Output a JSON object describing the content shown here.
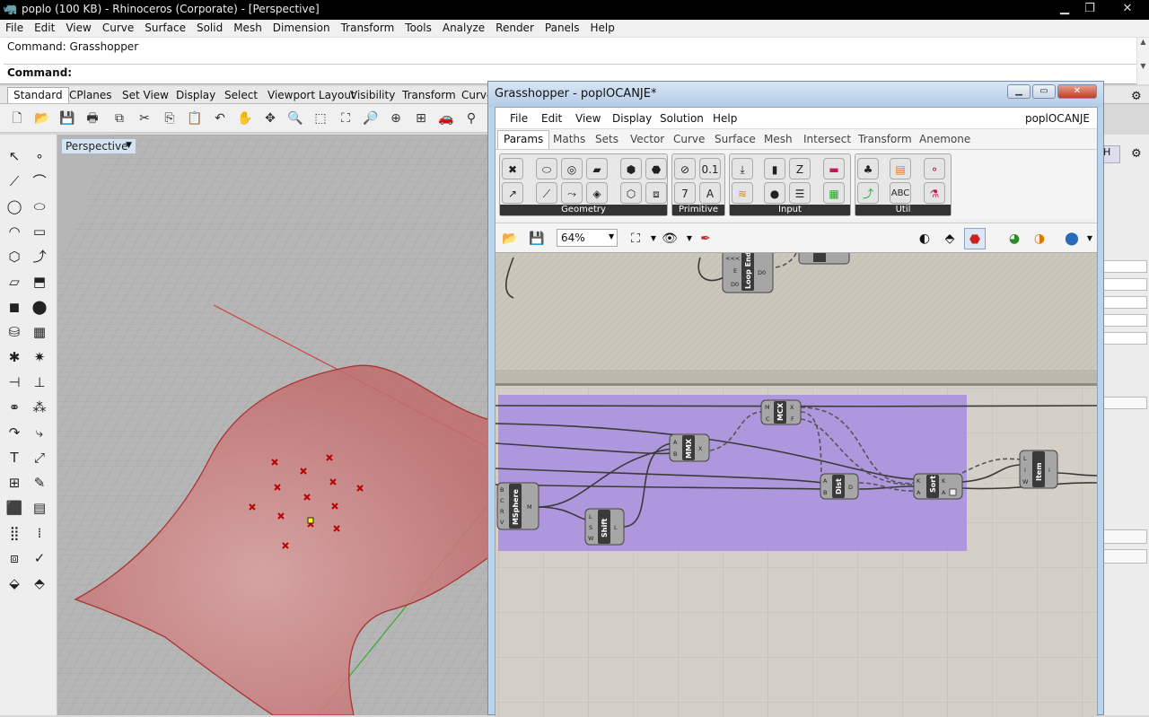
{
  "rhino": {
    "title": "poplo (100 KB) - Rhinoceros (Corporate) - [Perspective]",
    "menu": [
      "File",
      "Edit",
      "View",
      "Curve",
      "Surface",
      "Solid",
      "Mesh",
      "Dimension",
      "Transform",
      "Tools",
      "Analyze",
      "Render",
      "Panels",
      "Help"
    ],
    "command_history": "Command: Grasshopper",
    "command_prompt": "Command:",
    "toolbar_tabs": [
      "Standard",
      "CPlanes",
      "Set View",
      "Display",
      "Select",
      "Viewport Layout",
      "Visibility",
      "Transform",
      "Curve"
    ],
    "viewport_label": "Perspective"
  },
  "grasshopper": {
    "title": "Grasshopper - poplOCANJE*",
    "menu": [
      "File",
      "Edit",
      "View",
      "Display",
      "Solution",
      "Help"
    ],
    "document_name": "poplOCANJE",
    "tabs": [
      "Params",
      "Maths",
      "Sets",
      "Vector",
      "Curve",
      "Surface",
      "Mesh",
      "Intersect",
      "Transform",
      "Anemone"
    ],
    "ribbon_groups": [
      "Geometry",
      "Primitive",
      "Input",
      "Util"
    ],
    "zoom": "64%",
    "components": {
      "loop_end": {
        "name": "Loop End",
        "inputs": [
          "<<<",
          "E",
          "D0"
        ],
        "outputs": [
          "D0"
        ]
      },
      "mcx": {
        "name": "MCX",
        "inputs": [
          "M",
          "C"
        ],
        "outputs": [
          "X",
          "F"
        ]
      },
      "mmx": {
        "name": "MMX",
        "inputs": [
          "A",
          "B"
        ],
        "outputs": [
          "X"
        ]
      },
      "dist": {
        "name": "Dist",
        "inputs": [
          "A",
          "B"
        ],
        "outputs": [
          "D"
        ]
      },
      "sort": {
        "name": "Sort",
        "inputs": [
          "K",
          "A"
        ],
        "outputs": [
          "K",
          "A"
        ]
      },
      "item": {
        "name": "Item",
        "inputs": [
          "L",
          "i",
          "W"
        ],
        "outputs": [
          "i"
        ]
      },
      "msphere": {
        "name": "MSphere",
        "inputs": [
          "B",
          "C",
          "R",
          "V"
        ],
        "outputs": [
          "M"
        ]
      },
      "shift": {
        "name": "Shift",
        "inputs": [
          "L",
          "S",
          "W"
        ],
        "outputs": [
          "L"
        ]
      }
    }
  }
}
